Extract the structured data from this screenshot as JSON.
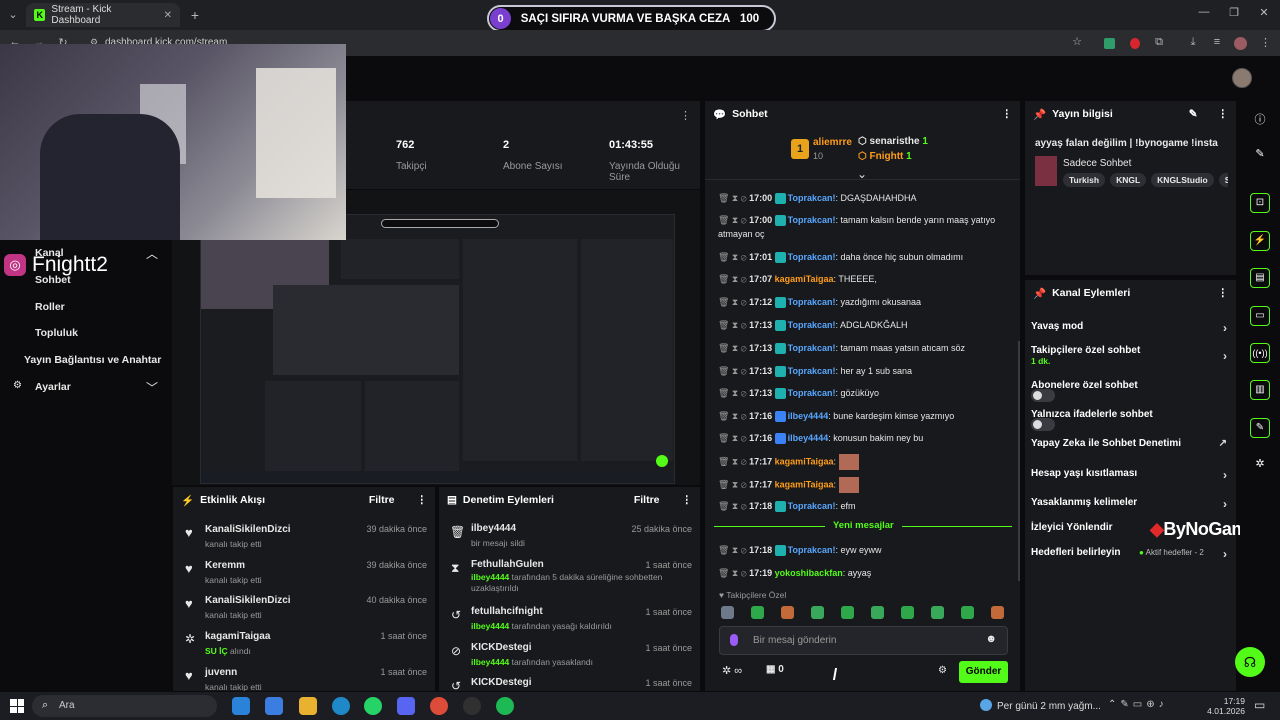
{
  "browser": {
    "tab_title": "Stream - Kick Dashboard",
    "url": "dashboard.kick.com/stream"
  },
  "overlay_bar": {
    "left": "0",
    "title": "SAÇI SIFIRA VURMA VE BAŞKA CEZA",
    "right": "100"
  },
  "webcam_overlay": {
    "handle": "Fnightt2"
  },
  "sidenav": {
    "items": [
      "Kanal",
      "Sohbet",
      "Roller",
      "Topluluk",
      "Yayın Bağlantısı ve Anahtar",
      "Ayarlar"
    ]
  },
  "stats": [
    {
      "value": "762",
      "label": "Takipçi"
    },
    {
      "value": "2",
      "label": "Abone Sayısı"
    },
    {
      "value": "01:43:55",
      "label": "Yayında Olduğu Süre"
    }
  ],
  "activity": {
    "title": "Etkinlik Akışı",
    "filter": "Filtre",
    "items": [
      {
        "user": "KanaliSikilenDizci",
        "desc": "kanalı takip etti",
        "time": "39 dakika önce"
      },
      {
        "user": "Keremm",
        "desc": "kanalı takip etti",
        "time": "39 dakika önce"
      },
      {
        "user": "KanaliSikilenDizci",
        "desc": "kanalı takip etti",
        "time": "40 dakika önce"
      },
      {
        "user": "kagamiTaigaa",
        "desc_green": "SU İÇ",
        "desc": "alındı",
        "time": "1 saat önce"
      },
      {
        "user": "juvenn",
        "desc": "kanalı takip etti",
        "time": "1 saat önce"
      }
    ]
  },
  "moderation": {
    "title": "Denetim Eylemleri",
    "filter": "Filtre",
    "items": [
      {
        "user": "ilbey4444",
        "desc": "bir mesajı sildi",
        "time": "25 dakika önce"
      },
      {
        "user": "FethullahGulen",
        "actor": "ilbey4444",
        "desc": "tarafından 5 dakika süreliğine sohbetten uzaklaştırıldı",
        "time": "1 saat önce"
      },
      {
        "user": "fetullahcifnight",
        "actor": "ilbey4444",
        "desc": "tarafından yasağı kaldırıldı",
        "time": "1 saat önce"
      },
      {
        "user": "KICKDestegi",
        "actor": "ilbey4444",
        "desc": "tarafından yasaklandı",
        "time": "1 saat önce"
      },
      {
        "user": "KICKDestegi",
        "desc": "",
        "time": "1 saat önce"
      }
    ]
  },
  "chat": {
    "title": "Sohbet",
    "top_gifter": {
      "rank": "1",
      "name": "aliemrre",
      "count": "10"
    },
    "pinned": [
      {
        "name": "senaristhe",
        "count": "1"
      },
      {
        "name": "Fnightt",
        "count": "1"
      }
    ],
    "messages": [
      {
        "time": "17:00",
        "user": "Toprakcan!",
        "color": "blue",
        "text": ": DGAŞDAHAHDHA"
      },
      {
        "time": "17:00",
        "user": "Toprakcan!",
        "color": "blue",
        "text": ": tamam kalsın bende yarın maaş yatıyo atmayan oç"
      },
      {
        "time": "17:01",
        "user": "Toprakcan!",
        "color": "blue",
        "text": ": daha önce hiç subun olmadımı"
      },
      {
        "time": "17:07",
        "user": "kagamiTaigaa",
        "color": "orange",
        "text": ": THEEEE,"
      },
      {
        "time": "17:12",
        "user": "Toprakcan!",
        "color": "blue",
        "text": ": yazdığımı okusanaa"
      },
      {
        "time": "17:13",
        "user": "Toprakcan!",
        "color": "blue",
        "text": ": ADGLADKĞALH"
      },
      {
        "time": "17:13",
        "user": "Toprakcan!",
        "color": "blue",
        "text": ": tamam maas yatsın atıcam söz"
      },
      {
        "time": "17:13",
        "user": "Toprakcan!",
        "color": "blue",
        "text": ": her ay 1 sub sana"
      },
      {
        "time": "17:13",
        "user": "Toprakcan!",
        "color": "blue",
        "text": ": gözüküyo"
      },
      {
        "time": "17:16",
        "user": "ilbey4444",
        "color": "blue",
        "text": ": bune kardeşim kimse yazmıyo"
      },
      {
        "time": "17:16",
        "user": "ilbey4444",
        "color": "blue",
        "text": ": konusun bakim ney bu"
      },
      {
        "time": "17:17",
        "user": "kagamiTaigaa",
        "color": "orange",
        "text": ":"
      },
      {
        "time": "17:17",
        "user": "kagamiTaigaa",
        "color": "orange",
        "text": ":"
      },
      {
        "time": "17:18",
        "user": "Toprakcan!",
        "color": "blue",
        "text": ": efm"
      }
    ],
    "new_messages_label": "Yeni mesajlar",
    "new_messages": [
      {
        "time": "17:18",
        "user": "Toprakcan!",
        "color": "blue",
        "text": ": eyw eyww"
      },
      {
        "time": "17:19",
        "user": "yokoshibackfan",
        "color": "green",
        "text": ": ayyaş"
      }
    ],
    "followers_only": "Takipçilere Özel",
    "input_placeholder": "Bir mesaj gönderin",
    "counter": "0",
    "send_label": "Gönder"
  },
  "stream_info": {
    "title": "Yayın bilgisi",
    "stream_title": "ayyaş falan değilim | !bynogame !insta",
    "category": "Sadece Sohbet",
    "tags": [
      "Turkish",
      "KNGL",
      "KNGLStudio",
      "So"
    ]
  },
  "channel_actions": {
    "title": "Kanal Eylemleri",
    "items": [
      {
        "label": "Yavaş mod",
        "control": "chevron"
      },
      {
        "label": "Takipçilere özel sohbet",
        "sub": "1 dk.",
        "control": "chevron"
      },
      {
        "label": "Abonelere özel sohbet",
        "control": "toggle"
      },
      {
        "label": "Yalnızca ifadelerle sohbet",
        "control": "toggle"
      },
      {
        "label": "Yapay Zeka ile Sohbet Denetimi",
        "control": "external"
      },
      {
        "label": "Hesap yaşı kısıtlaması",
        "control": "chevron"
      },
      {
        "label": "Yasaklanmış kelimeler",
        "control": "chevron"
      },
      {
        "label": "İzleyici Yönlendir",
        "control": "none"
      },
      {
        "label": "Hedefleri belirleyin",
        "sub": "Aktif hedefler - 2",
        "control": "chevron"
      }
    ]
  },
  "watermark": "ByNoGame",
  "taskbar": {
    "search": "Ara",
    "weather": "Per günü 2 mm yağm...",
    "time": "17:19",
    "date": "4.01.2026"
  },
  "colors": {
    "accent": "#53fc18",
    "panel": "#18191c",
    "background": "#0b0b0d"
  }
}
